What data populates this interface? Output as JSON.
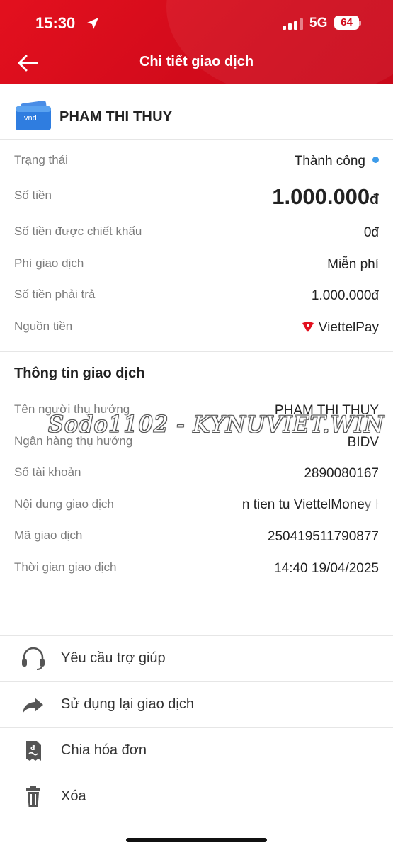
{
  "status_bar": {
    "time": "15:30",
    "network": "5G",
    "battery": "64"
  },
  "header": {
    "title": "Chi tiết giao dịch"
  },
  "account": {
    "wallet_label": "vnd",
    "name": "PHAM THI THUY"
  },
  "summary": {
    "status_label": "Trạng thái",
    "status_value": "Thành công",
    "amount_label": "Số tiền",
    "amount_value": "1.000.000",
    "amount_currency": "đ",
    "discount_label": "Số tiền được chiết khấu",
    "discount_value": "0đ",
    "fee_label": "Phí giao dịch",
    "fee_value": "Miễn phí",
    "payable_label": "Số tiền phải trả",
    "payable_value": "1.000.000đ",
    "source_label": "Nguồn tiền",
    "source_value": "ViettelPay"
  },
  "details": {
    "section_title": "Thông tin giao dịch",
    "beneficiary_label": "Tên người thụ hưởng",
    "beneficiary_value": "PHAM THI THUY",
    "bank_label": "Ngân hàng thụ hưởng",
    "bank_value": "BIDV",
    "account_no_label": "Số tài khoản",
    "account_no_value": "2890080167",
    "content_label": "Nội dung giao dịch",
    "content_value": "n tien tu ViettelMoney   HC",
    "txn_id_label": "Mã giao dịch",
    "txn_id_value": "250419511790877",
    "time_label": "Thời gian giao dịch",
    "time_value": "14:40 19/04/2025"
  },
  "watermark": "Sodo1102 - KYNUVIET.WIN",
  "actions": [
    {
      "label": "Yêu cầu trợ giúp",
      "icon": "headset-icon"
    },
    {
      "label": "Sử dụng lại giao dịch",
      "icon": "share-arrow-icon"
    },
    {
      "label": "Chia hóa đơn",
      "icon": "receipt-icon"
    },
    {
      "label": "Xóa",
      "icon": "trash-icon"
    }
  ],
  "colors": {
    "brand": "#d20b1b",
    "status_dot": "#3d9be9"
  }
}
